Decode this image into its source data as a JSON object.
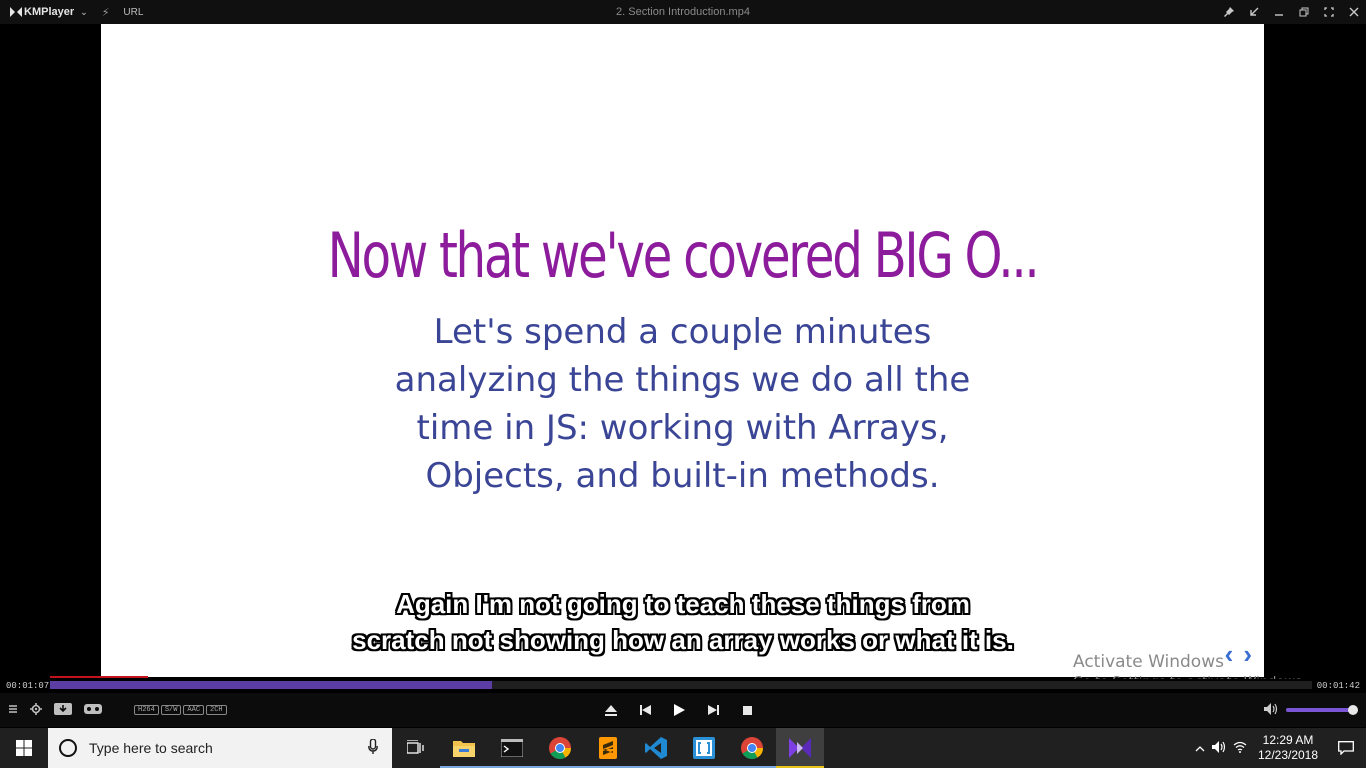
{
  "titlebar": {
    "app_name": "KMPlayer",
    "url_label": "URL",
    "file_title": "2. Section Introduction.mp4"
  },
  "slide": {
    "title": "Now that we've covered BIG O...",
    "body_lines": [
      "Let's spend a couple minutes",
      "analyzing the things we do all the",
      "time in JS: working with Arrays,",
      "Objects, and built-in methods."
    ]
  },
  "subtitle": {
    "line1": "Again I'm not going to teach these things from",
    "line2": "scratch not showing how an array works or what it is."
  },
  "watermark": {
    "line1": "Activate Windows",
    "line2": "Go to Settings to activate Windows."
  },
  "player": {
    "current_time": "00:01:07",
    "total_time": "00:01:42",
    "progress_fraction": 0.35,
    "volume_fraction": 0.98,
    "badges": [
      "H264",
      "S/W",
      "AAC",
      "2CH"
    ]
  },
  "taskbar": {
    "search_placeholder": "Type here to search",
    "clock_time": "12:29 AM",
    "clock_date": "12/23/2018"
  },
  "colors": {
    "slide_title": "#8c1c9c",
    "slide_body": "#3a4596",
    "seek_played": "#5b3da3",
    "volume_fill": "#7a56d6"
  }
}
